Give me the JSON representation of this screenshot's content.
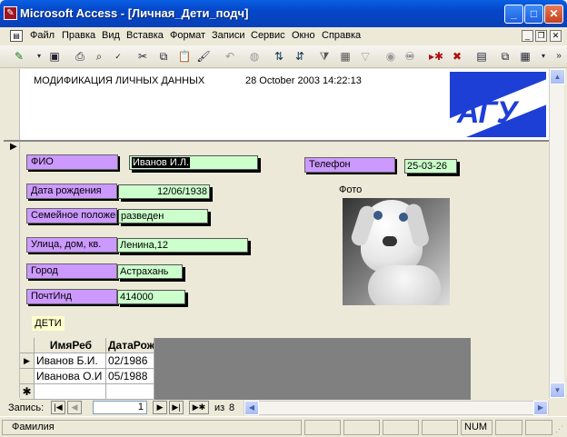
{
  "window": {
    "title": "Microsoft Access - [Личная_Дети_подч]"
  },
  "menu": [
    {
      "label": "Файл"
    },
    {
      "label": "Правка"
    },
    {
      "label": "Вид"
    },
    {
      "label": "Вставка"
    },
    {
      "label": "Формат"
    },
    {
      "label": "Записи"
    },
    {
      "label": "Сервис"
    },
    {
      "label": "Окно"
    },
    {
      "label": "Справка"
    }
  ],
  "header": {
    "title": "МОДИФИКАЦИЯ ЛИЧНЫХ ДАННЫХ",
    "datetime": "28 October 2003 14:22:13",
    "logo_text": "АГУ"
  },
  "fields": {
    "fio": {
      "label": "ФИО",
      "value": "Иванов И.Л."
    },
    "birth": {
      "label": "Дата рождения",
      "value": "12/06/1938"
    },
    "marital": {
      "label": "Семейное положение",
      "value": "разведен"
    },
    "street": {
      "label": "Улица, дом, кв.",
      "value": "Ленина,12"
    },
    "city": {
      "label": "Город",
      "value": "Астрахань"
    },
    "zip": {
      "label": "ПочтИнд",
      "value": "414000"
    },
    "phone": {
      "label": "Телефон",
      "value": "25-03-26"
    }
  },
  "photo": {
    "label": "Фото"
  },
  "children": {
    "label": "ДЕТИ",
    "columns": [
      "ИмяРеб",
      "ДатаРож"
    ],
    "rows": [
      [
        "Иванов Б.И.",
        "02/1986"
      ],
      [
        "Иванова О.И",
        "05/1988"
      ]
    ]
  },
  "nav": {
    "label": "Запись:",
    "current": "1",
    "of_label": "из",
    "total": "8"
  },
  "status": {
    "text": "Фамилия",
    "num": "NUM"
  }
}
